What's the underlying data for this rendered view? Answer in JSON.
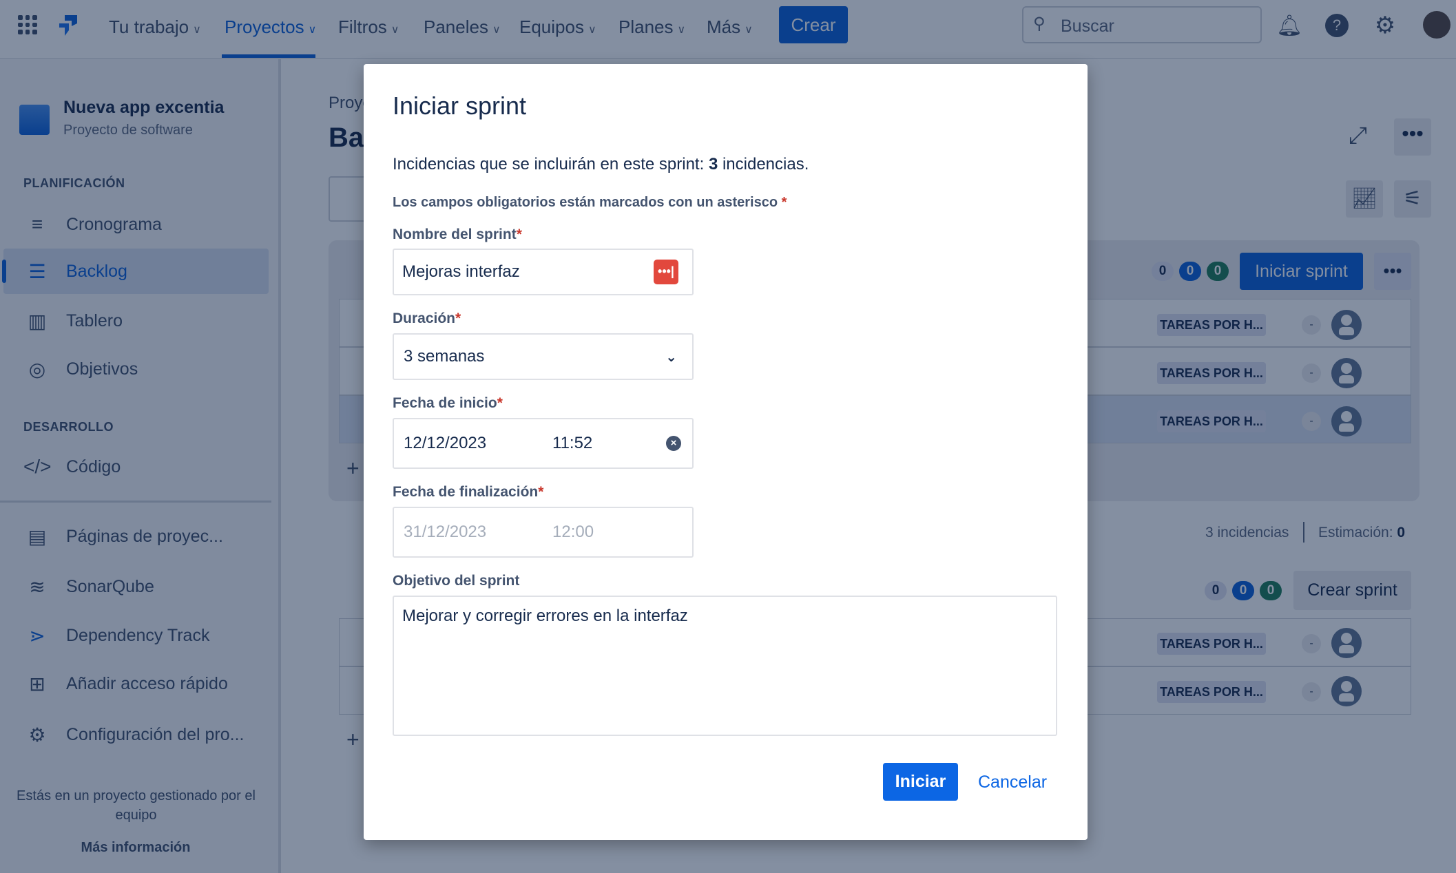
{
  "topbar": {
    "nav": [
      "Tu trabajo",
      "Proyectos",
      "Filtros",
      "Paneles",
      "Equipos",
      "Planes",
      "Más"
    ],
    "active": "Proyectos",
    "create": "Crear",
    "search_placeholder": "Buscar"
  },
  "sidebar": {
    "project_name": "Nueva app excentia",
    "project_type": "Proyecto de software",
    "planning_heading": "PLANIFICACIÓN",
    "planning": [
      "Cronograma",
      "Backlog",
      "Tablero",
      "Objetivos"
    ],
    "dev_heading": "DESARROLLO",
    "dev": [
      "Código"
    ],
    "extra": [
      "Páginas de proyec...",
      "SonarQube",
      "Dependency Track",
      "Añadir acceso rápido",
      "Configuración del pro..."
    ],
    "footer": "Estás en un proyecto gestionado por el equipo",
    "more_info": "Más información"
  },
  "main": {
    "breadcrumb": "Proyectos",
    "title": "Backlog",
    "sprint": {
      "counts": [
        "0",
        "0",
        "0"
      ],
      "start_button": "Iniciar sprint",
      "rows": [
        "TAREAS POR H...",
        "TAREAS POR H...",
        "TAREAS POR H..."
      ],
      "estimate_dash": "-",
      "issues": "3 incidencias",
      "estimate_label": "Estimación:",
      "estimate_value": "0"
    },
    "backlog": {
      "counts": [
        "0",
        "0",
        "0"
      ],
      "create_button": "Crear sprint",
      "rows": [
        "TAREAS POR H...",
        "TAREAS POR H..."
      ]
    }
  },
  "modal": {
    "title": "Iniciar sprint",
    "intro_prefix": "Incidencias que se incluirán en este sprint:",
    "intro_count": "3",
    "intro_suffix": "incidencias.",
    "required_note": "Los campos obligatorios están marcados con un asterisco",
    "asterisk": "*",
    "name_label": "Nombre del sprint",
    "name_value": "Mejoras interfaz",
    "duration_label": "Duración",
    "duration_value": "3 semanas",
    "start_label": "Fecha de inicio",
    "start_date": "12/12/2023",
    "start_time": "11:52",
    "end_label": "Fecha de finalización",
    "end_date": "31/12/2023",
    "end_time": "12:00",
    "goal_label": "Objetivo del sprint",
    "goal_value": "Mejorar y corregir errores en la interfaz",
    "submit": "Iniciar",
    "cancel": "Cancelar"
  },
  "colors": {
    "brand": "#0c66e4",
    "required": "#c9372c"
  }
}
